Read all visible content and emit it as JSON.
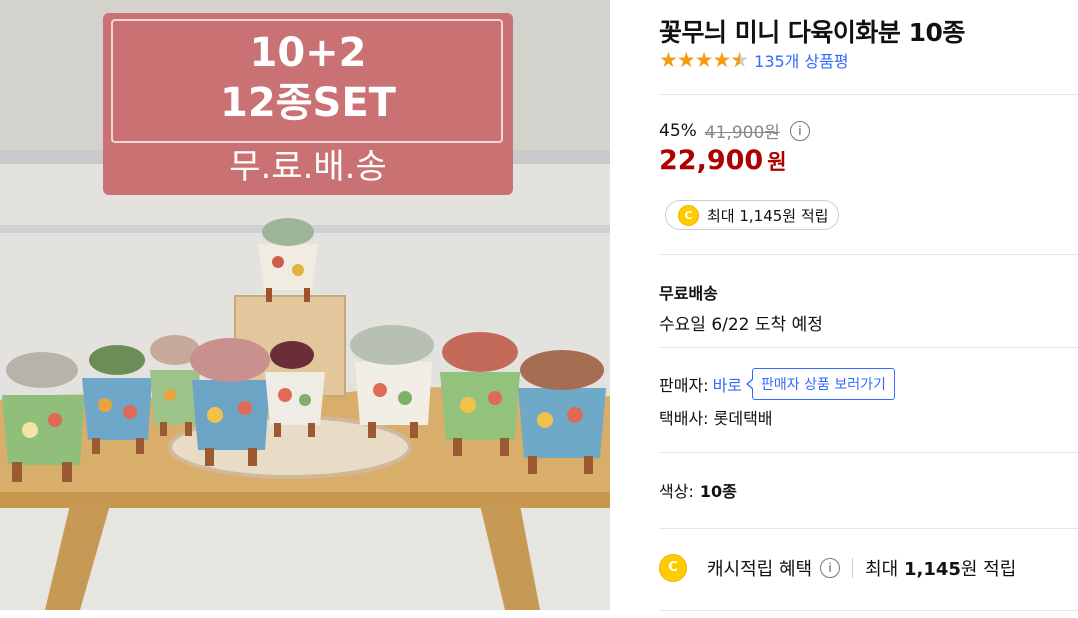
{
  "product_image": {
    "promo_line1": "10+2",
    "promo_line2": "12종SET",
    "promo_line3": "무.료.배.송"
  },
  "product": {
    "title": "꽃무늬 미니 다육이화분 10종",
    "rating_stars": 4.5,
    "review_count": "135개 상품평"
  },
  "price": {
    "discount_rate": "45%",
    "original_price": "41,900원",
    "sale_price": "22,900",
    "sale_unit": "원"
  },
  "reward_chip": {
    "coin_label": "C",
    "text": "최대 1,145원 적립"
  },
  "shipping": {
    "title": "무료배송",
    "arrival": "수요일 6/22 도착 예정"
  },
  "seller": {
    "label": "판매자:",
    "name": "바로",
    "tooltip": "판매자 상품 보러가기",
    "courier": "택배사: 롯데택배"
  },
  "option": {
    "label": "색상:",
    "value": "10종"
  },
  "cash_reward": {
    "coin_label": "C",
    "label": "캐시적립 혜택",
    "prefix": "최대",
    "amount": "1,145",
    "suffix": "원 적립"
  },
  "icons": {
    "info": "info-icon",
    "star": "star-icon",
    "coin": "coupang-cash-coin-icon"
  },
  "colors": {
    "accent_blue": "#346aff",
    "sale_red": "#ae0000",
    "star_orange": "#f39c12",
    "promo_pink": "#c97173"
  }
}
